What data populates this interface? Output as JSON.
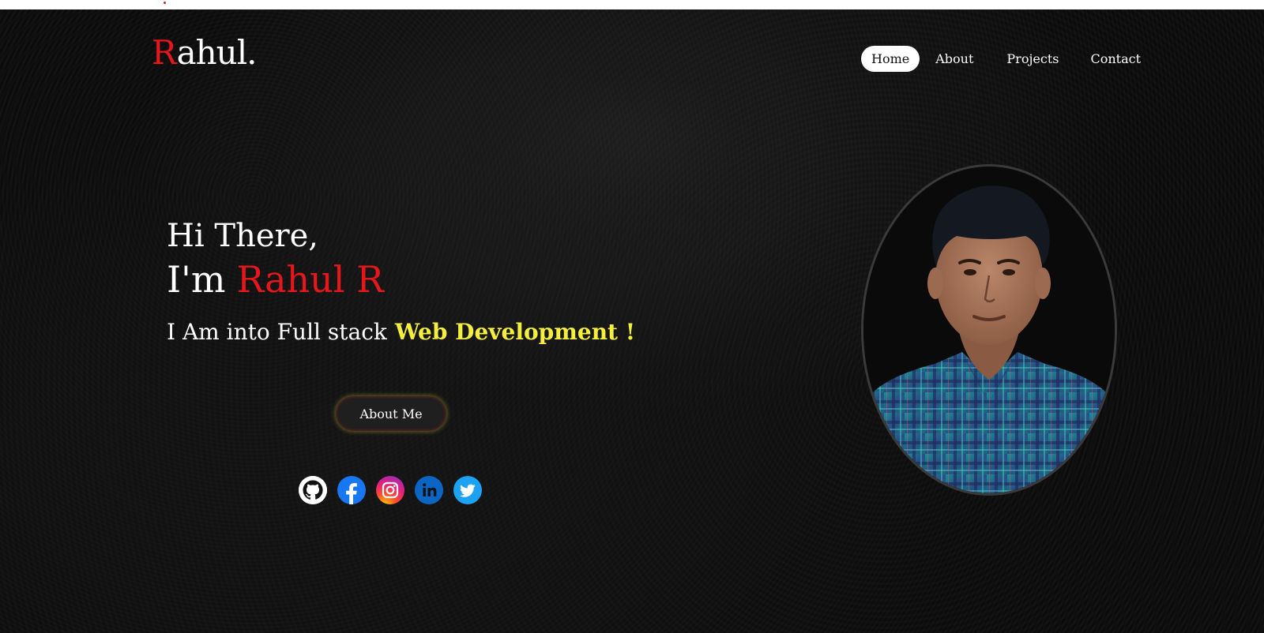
{
  "brand": {
    "initial": "R",
    "rest": "ahul."
  },
  "nav": {
    "items": [
      {
        "label": "Home",
        "active": true
      },
      {
        "label": "About",
        "active": false
      },
      {
        "label": "Projects",
        "active": false
      },
      {
        "label": "Contact",
        "active": false
      }
    ]
  },
  "hero": {
    "greeting": "Hi There,",
    "intro_prefix": "I'm",
    "name": "Rahul R",
    "tagline_prefix": "I Am into Full stack",
    "tagline_typed": "Web Development !",
    "cta_label": "About Me"
  },
  "socials": [
    {
      "icon": "github-icon"
    },
    {
      "icon": "facebook-icon"
    },
    {
      "icon": "instagram-icon"
    },
    {
      "icon": "linkedin-icon"
    },
    {
      "icon": "twitter-icon"
    }
  ],
  "colors": {
    "accent_red": "#e5171b",
    "typed_yellow": "#f4ee3e",
    "background": "#0b0b0b",
    "facebook_blue": "#1877f2",
    "linkedin_blue": "#0a66c2",
    "twitter_blue": "#1da1f2"
  }
}
